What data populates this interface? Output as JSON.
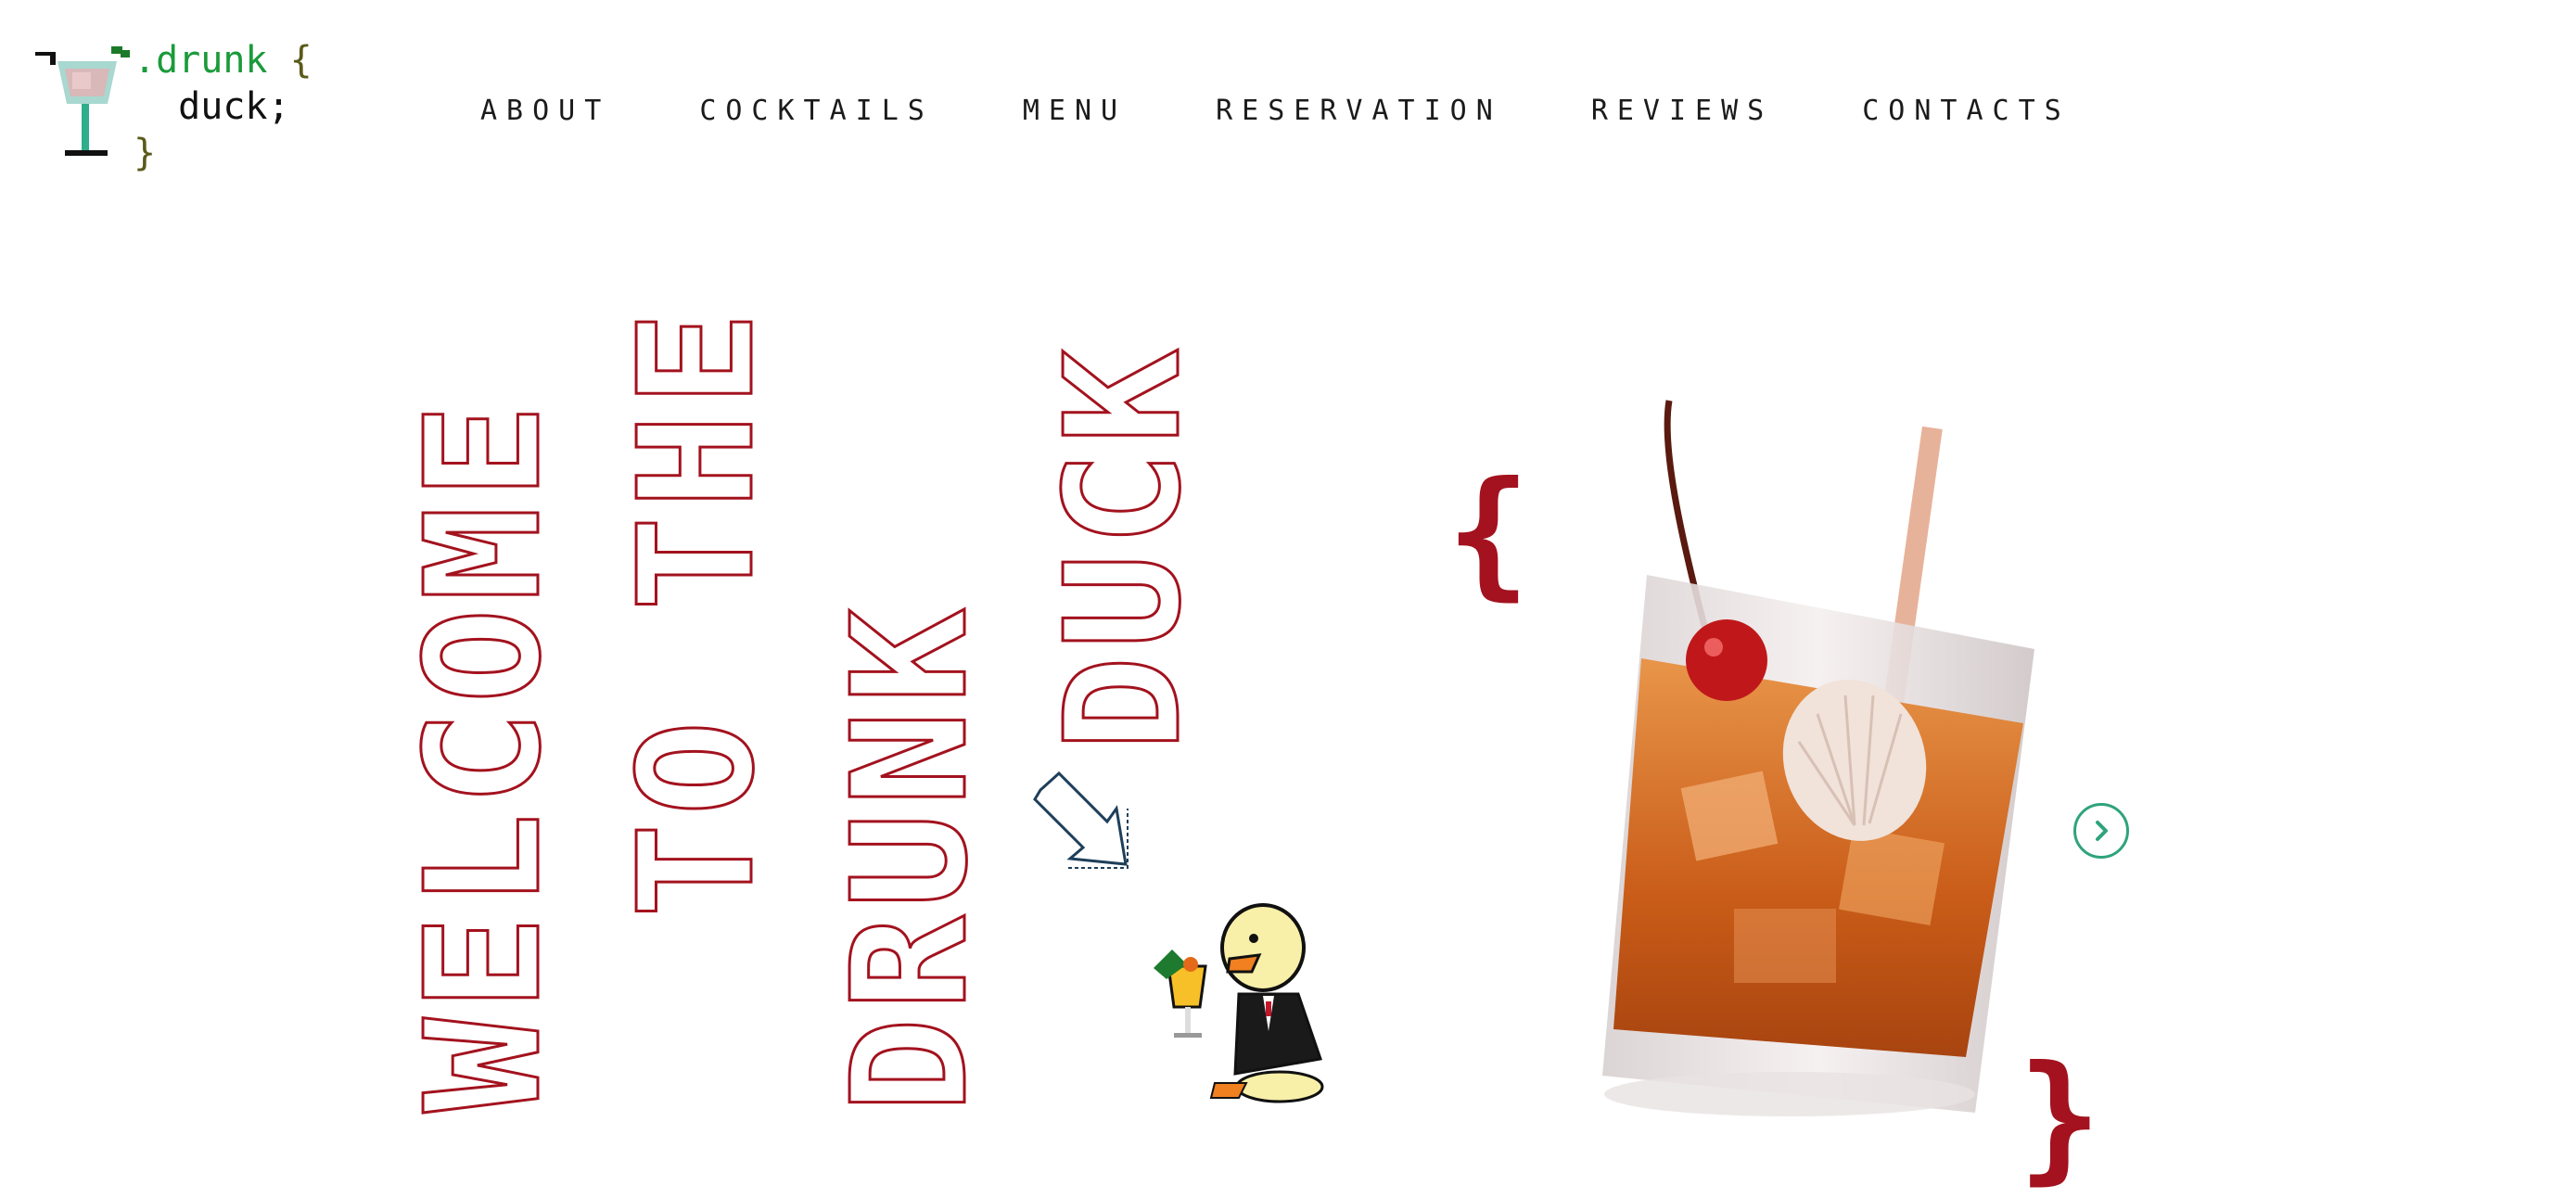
{
  "logo": {
    "line1_prefix": ".drunk",
    "line1_brace": "{",
    "line2": "duck;",
    "line3_brace": "}",
    "icon": "cocktail-glass-icon"
  },
  "nav": {
    "items": [
      {
        "label": "ABOUT"
      },
      {
        "label": "COCKTAILS"
      },
      {
        "label": "MENU"
      },
      {
        "label": "RESERVATION"
      },
      {
        "label": "REVIEWS"
      },
      {
        "label": "CONTACTS"
      }
    ]
  },
  "hero": {
    "words": [
      "WELCOME",
      "TO THE",
      "DRUNK",
      "DUCK"
    ],
    "open_brace": "{",
    "close_brace": "}",
    "arrow_icon": "arrow-down-right-icon",
    "duck_icon": "duck-mascot-icon",
    "drink_image": "cocktail-photo",
    "next_icon": "chevron-right-icon"
  },
  "colors": {
    "accent_red": "#a3121e",
    "logo_green": "#1a9b3a",
    "button_green": "#2fa37c",
    "arrow_navy": "#1e3f5a",
    "text_dark": "#1b1b1b"
  }
}
